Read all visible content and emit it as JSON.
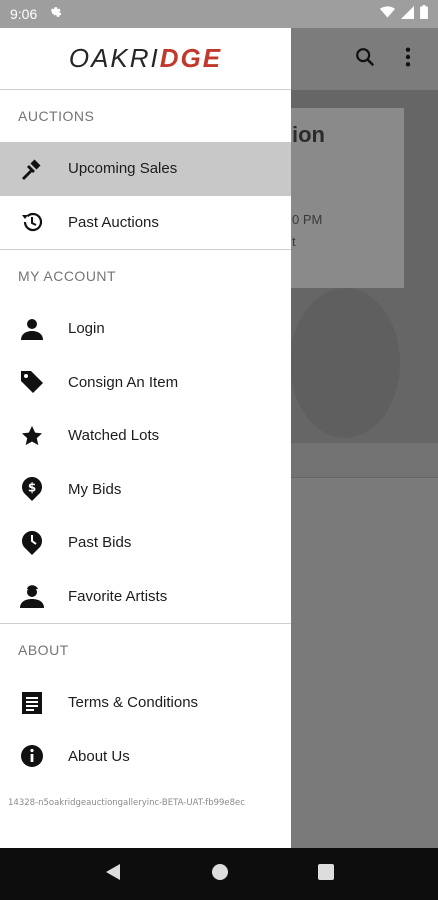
{
  "status_bar": {
    "time": "9:06",
    "icons": [
      "gear-icon",
      "wifi-icon",
      "signal-icon",
      "battery-icon"
    ]
  },
  "background": {
    "title_fragment": "ion",
    "time_fragment": "0 PM",
    "line_fragment": "t"
  },
  "drawer": {
    "logo_text_a": "OAKRI",
    "logo_text_b": "DGE",
    "sections": {
      "auctions": {
        "header": "AUCTIONS",
        "items": [
          {
            "label": "Upcoming Sales",
            "icon": "gavel-icon"
          },
          {
            "label": "Past Auctions",
            "icon": "history-icon"
          }
        ]
      },
      "account": {
        "header": "MY ACCOUNT",
        "items": [
          {
            "label": "Login",
            "icon": "person-icon"
          },
          {
            "label": "Consign An Item",
            "icon": "tag-icon"
          },
          {
            "label": "Watched Lots",
            "icon": "star-icon"
          },
          {
            "label": "My Bids",
            "icon": "dollar-pin-icon"
          },
          {
            "label": "Past Bids",
            "icon": "clock-pin-icon"
          },
          {
            "label": "Favorite Artists",
            "icon": "artist-icon"
          }
        ]
      },
      "about": {
        "header": "ABOUT",
        "items": [
          {
            "label": "Terms & Conditions",
            "icon": "document-icon"
          },
          {
            "label": "About Us",
            "icon": "info-icon"
          }
        ]
      }
    },
    "version": "14328-n5oakridgeauctiongalleryinc-BETA-UAT-fb99e8ec"
  },
  "colors": {
    "accent": "#c0392b",
    "active_bg": "#c8c8c8",
    "drawer_bg": "#ffffff"
  }
}
